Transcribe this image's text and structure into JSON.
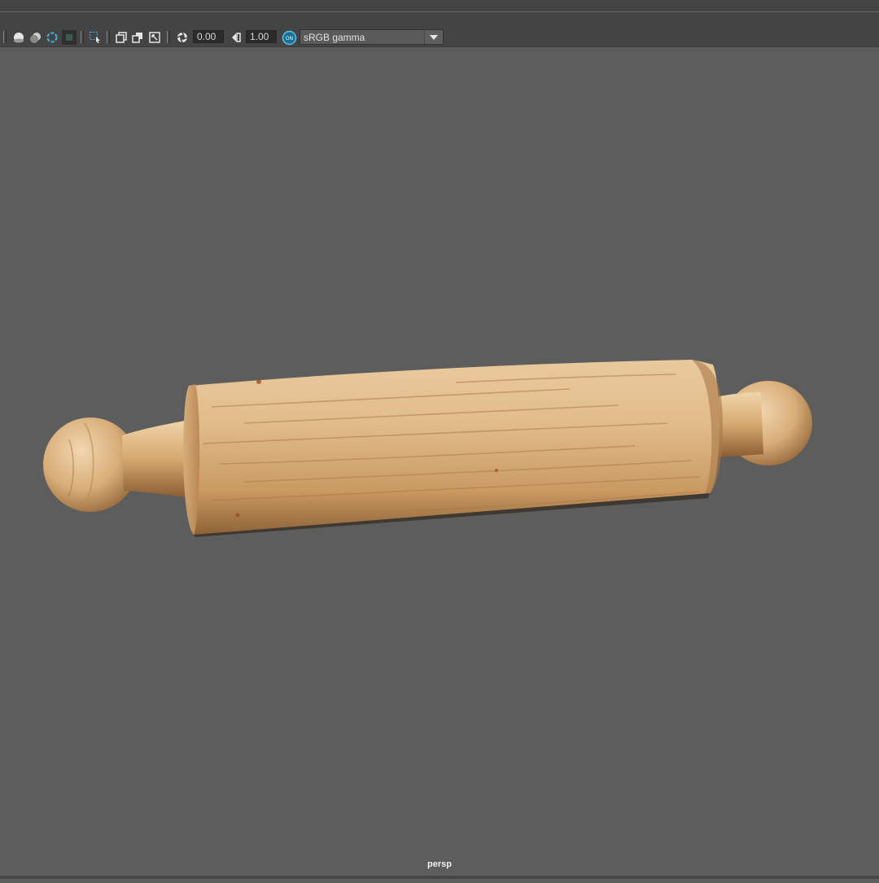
{
  "toolbar": {
    "exposure_value": "0.00",
    "gamma_value": "1.00",
    "colorspace_value": "sRGB gamma",
    "color_management_badge": "ON",
    "icons": [
      "shaded-sphere-icon",
      "wireframe-on-shaded-icon",
      "xray-icon",
      "isolate-select-icon",
      "select-camera-icon",
      "image-plane-icon",
      "grid-icon",
      "frame-resize-icon",
      "exposure-icon",
      "gamma-icon",
      "color-management-icon",
      "chevron-down-icon"
    ]
  },
  "viewport": {
    "camera_name": "persp",
    "object": "rolling-pin"
  },
  "colors": {
    "viewport_bg": "#5d5d5d",
    "toolbar_bg": "#444444",
    "accent": "#2a98c8"
  }
}
